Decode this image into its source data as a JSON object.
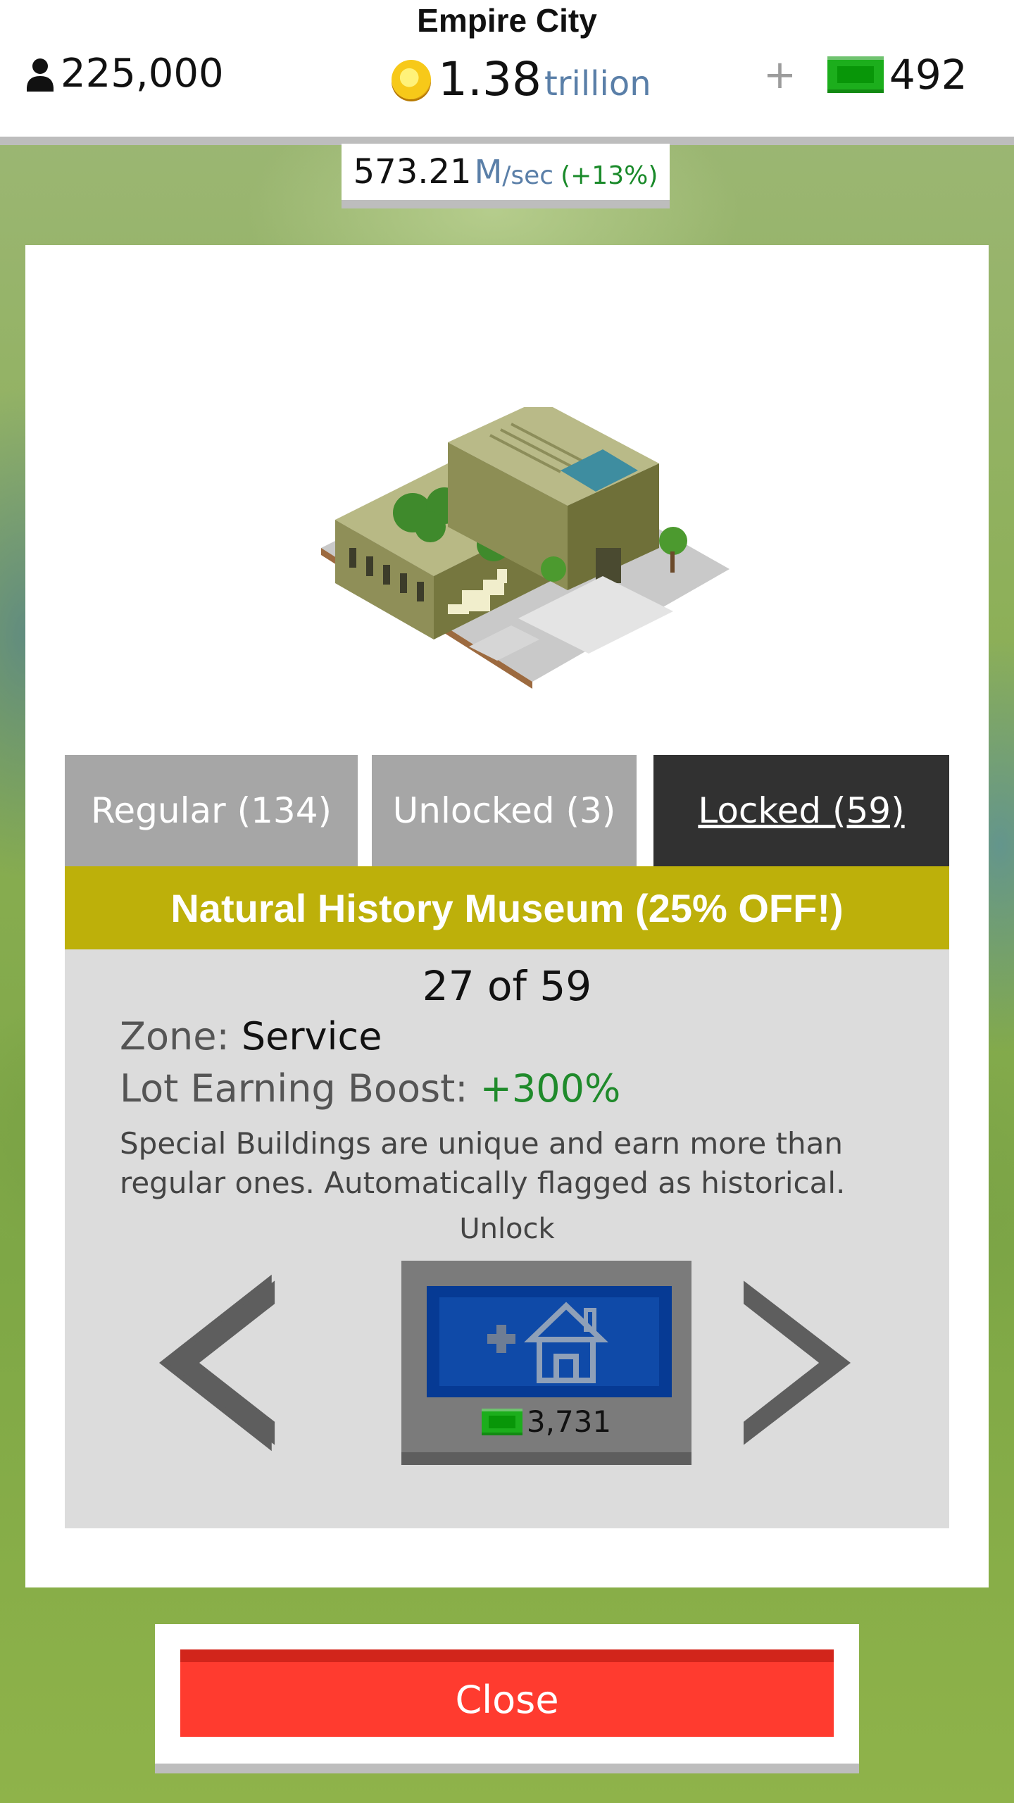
{
  "header": {
    "city_name": "Empire City",
    "population": "225,000",
    "money_value": "1.38",
    "money_unit": "trillion",
    "gems_plus": "+",
    "gems": "492"
  },
  "rate": {
    "value": "573.21",
    "unit": "M",
    "per": "/sec",
    "percent": "(+13%)"
  },
  "tabs": [
    {
      "label": "Regular (134)",
      "selected": false
    },
    {
      "label": "Unlocked (3)",
      "selected": false
    },
    {
      "label": "Locked (59)",
      "selected": true
    }
  ],
  "building": {
    "title": "Natural History Museum (25% OFF!)",
    "counter": "27 of 59",
    "zone_label": "Zone:",
    "zone_value": "Service",
    "boost_label": "Lot Earning Boost:",
    "boost_value": "+300%",
    "description": "Special Buildings are unique and earn more than regular ones. Automatically flagged as historical."
  },
  "unlock": {
    "label": "Unlock",
    "cost": "3,731",
    "plus_icon": "plus-icon",
    "house_icon": "house-icon"
  },
  "close_label": "Close",
  "colors": {
    "title_bar": "#bdb00a",
    "locked_tab": "#313131",
    "tab_gray": "#a6a6a6",
    "close_red": "#ff3b2f",
    "boost_green": "#1f8a2b",
    "gem_green": "#1cae1c"
  }
}
